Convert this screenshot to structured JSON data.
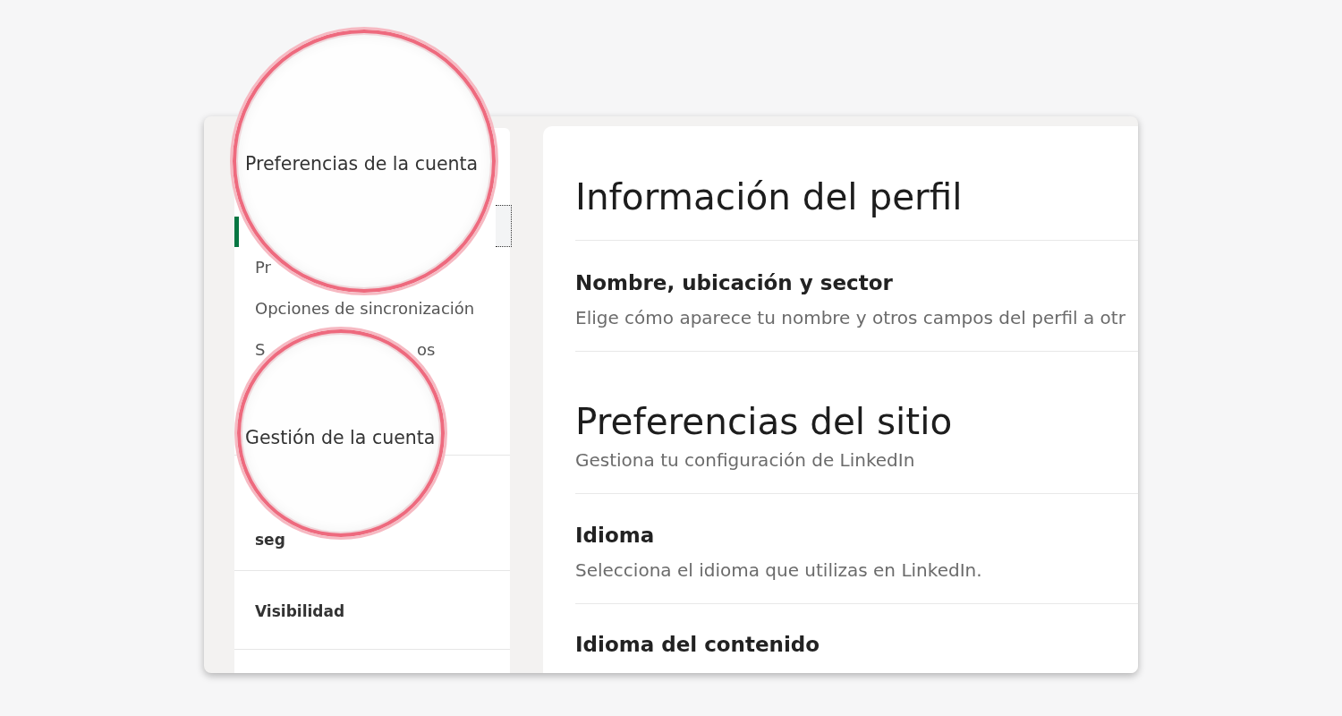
{
  "callouts": [
    {
      "label": "Preferencias de la cuenta"
    },
    {
      "label": "Gestión de la cuenta"
    }
  ],
  "sidebar": {
    "items": [
      {
        "selected": true
      },
      {
        "label": "Pr",
        "selected": false
      },
      {
        "label": "Opciones de sincronización",
        "selected": false
      },
      {
        "label": "S",
        "label_end": "os",
        "selected": false
      }
    ],
    "sections": [
      {
        "label": "seg"
      },
      {
        "label": "Visibilidad"
      }
    ]
  },
  "content": {
    "sections": [
      {
        "title": "Información del perfil",
        "rows": [
          {
            "title": "Nombre, ubicación y sector",
            "description": "Elige cómo aparece tu nombre y otros campos del perfil a otr"
          }
        ]
      },
      {
        "title": "Preferencias del sitio",
        "subtitle": "Gestiona tu configuración de LinkedIn",
        "rows": [
          {
            "title": "Idioma",
            "description": "Selecciona el idioma que utilizas en LinkedIn."
          },
          {
            "title": "Idioma del contenido"
          }
        ]
      }
    ]
  }
}
